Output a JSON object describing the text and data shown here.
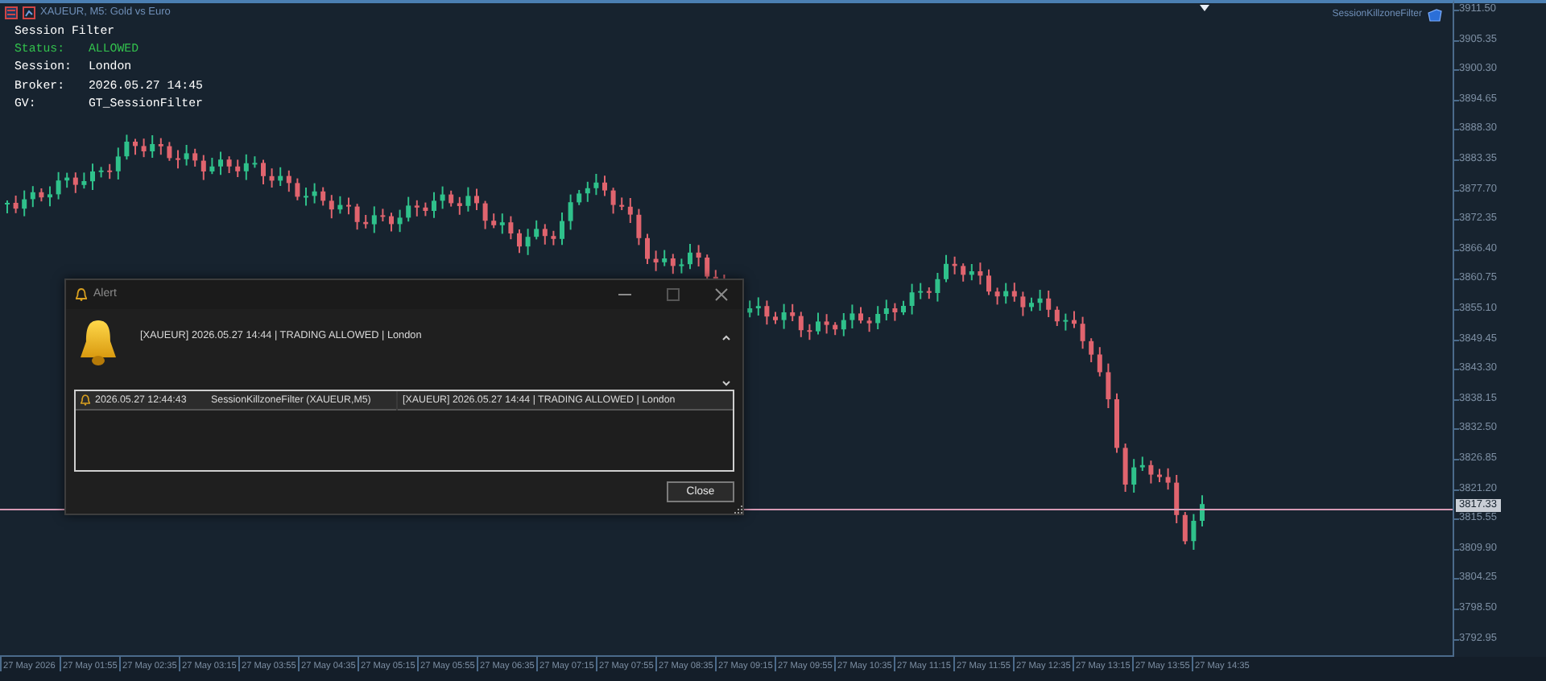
{
  "chart": {
    "title": "XAUEUR, M5:  Gold vs Euro",
    "indicator_label": "SessionKillzoneFilter",
    "info_panel": [
      {
        "label": "Session Filter",
        "color": "#ffffff"
      },
      {
        "label": "Status:",
        "value": "ALLOWED",
        "color": "#33c24d"
      },
      {
        "label": "Session:",
        "value": "London",
        "color": "#ffffff"
      },
      {
        "label": "Broker:",
        "value": "2026.05.27 14:45",
        "color": "#ffffff"
      },
      {
        "label": "GV:",
        "value": "GT_SessionFilter",
        "color": "#ffffff"
      }
    ],
    "price_axis": [
      "3911.50",
      "3905.35",
      "3900.30",
      "3894.65",
      "3888.30",
      "3883.35",
      "3877.70",
      "3872.35",
      "3866.40",
      "3860.75",
      "3855.10",
      "3849.45",
      "3843.30",
      "3838.15",
      "3832.50",
      "3826.85",
      "3821.20",
      "3815.55",
      "3809.90",
      "3804.25",
      "3798.50",
      "3792.95"
    ],
    "current_price": "3817.33",
    "time_axis": [
      "27 May 2026",
      "27 May 01:55",
      "27 May 02:35",
      "27 May 03:15",
      "27 May 03:55",
      "27 May 04:35",
      "27 May 05:15",
      "27 May 05:55",
      "27 May 06:35",
      "27 May 07:15",
      "27 May 07:55",
      "27 May 08:35",
      "27 May 09:15",
      "27 May 09:55",
      "27 May 10:35",
      "27 May 11:15",
      "27 May 11:55",
      "27 May 12:35",
      "27 May 13:15",
      "27 May 13:55",
      "27 May 14:35"
    ]
  },
  "alert_dialog": {
    "title": "Alert",
    "message": "[XAUEUR] 2026.05.27 14:44 | TRADING ALLOWED | London",
    "log": [
      {
        "time": "2026.05.27 12:44:43",
        "source": "SessionKillzoneFilter (XAUEUR,M5)",
        "message": "[XAUEUR] 2026.05.27 14:44 | TRADING ALLOWED | London",
        "selected": true
      }
    ],
    "close_button": "Close"
  }
}
